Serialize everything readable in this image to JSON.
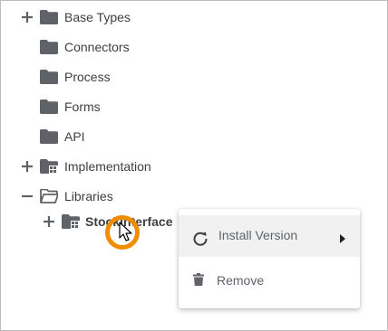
{
  "tree": {
    "items": [
      {
        "label": "Base Types",
        "expander": "+",
        "icon": "folder-icon"
      },
      {
        "label": "Connectors",
        "icon": "folder-icon"
      },
      {
        "label": "Process",
        "icon": "folder-icon"
      },
      {
        "label": "Forms",
        "icon": "folder-icon"
      },
      {
        "label": "API",
        "icon": "folder-icon"
      },
      {
        "label": "Implementation",
        "expander": "+",
        "icon": "implementation-folder-icon"
      },
      {
        "label": "Libraries",
        "expander": "−",
        "icon": "folder-open-icon"
      },
      {
        "label": "StockInterface",
        "expander": "+",
        "icon": "library-folder-icon"
      }
    ]
  },
  "context_menu": {
    "install_version_label": "Install Version",
    "remove_label": "Remove"
  },
  "colors": {
    "icon": "#5f6368",
    "cursor_ring": "#ef8c00",
    "menu_hover": "#f1f1f1"
  }
}
